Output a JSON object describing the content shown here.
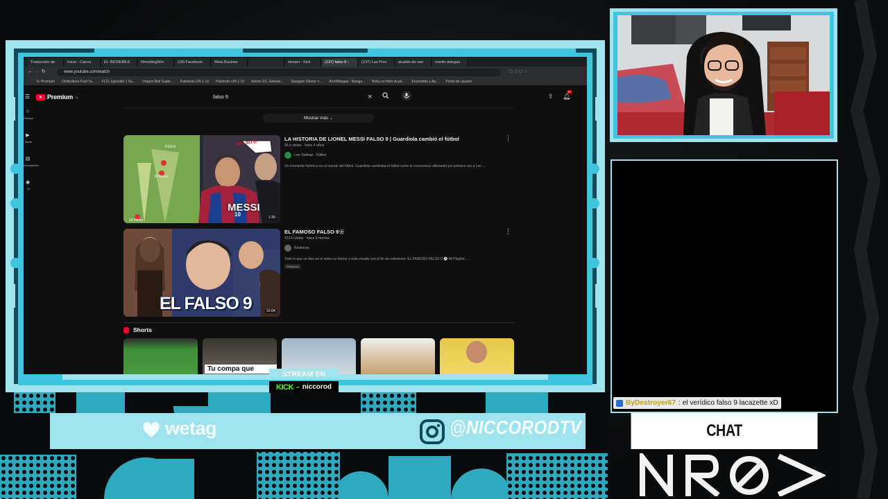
{
  "browser": {
    "tabs": [
      "Traducción de",
      "Inicio - Canva",
      "EL INCREIBLE",
      "WrestlingWor",
      "(18) Facebook",
      "Meta Busines",
      "",
      "stream - Kick",
      "(137) falso 9 -",
      "(137) Las Prec",
      "alcalde de san",
      "martin ødegaa"
    ],
    "active_tab_index": 8,
    "url": "www.youtube.com/watch",
    "bookmarks": [
      "Tv Premium",
      "Ochikobore Fruit Ta...",
      "FLCL Episodio 1 Su...",
      "Dragon Ball Super...",
      "Paletools v25.1.15",
      "Paletools v25.1.12",
      "Anime-SS, Gekkan...",
      "Tasogare Otome ×...",
      "ArchMangas - Manga...",
      "Boku no Hero Acad...",
      "Encendido y Ap...",
      "Portal de usuario"
    ]
  },
  "youtube": {
    "brand": "Premium",
    "brand_sup": "CL",
    "search_query": "falso 9",
    "notification_count": "9+",
    "sidebar": [
      {
        "icon": "home-icon",
        "label": "Principal"
      },
      {
        "icon": "shorts-icon",
        "label": "Shorts"
      },
      {
        "icon": "subscriptions-icon",
        "label": "Suscripciones"
      },
      {
        "icon": "you-icon",
        "label": "Tú"
      }
    ],
    "show_more": "Mostrar más",
    "videos": [
      {
        "title": "LA HISTORIA DE LIONEL MESSI FALSO 9 | Guardiola cambió el fútbol",
        "meta": "96 k vistas · hace 4 años",
        "channel": "Leo Salinas · Fútbol",
        "description": "Un momento histórico en el mundo del fútbol. Guardiola cambiaba el fútbol como lo conocemos utilizando por primera vez a Leo ...",
        "duration": "1:35",
        "thumb_text": [
          "¡FALSO 9!",
          "MESSI",
          "10",
          "9 Eto'o",
          "10 Messi",
          "14 Henry"
        ]
      },
      {
        "title": "EL FAMOSO FALSO 9",
        "meta": "151 k vistas · hace 9 meses",
        "channel": "Kevinnnn",
        "description": "Todo lo que se dice en el video es humor y esta creado con el fin de entretener. EL FAMOSO FALSO 9 ⚽ Mi Playlist: ...",
        "chip": "Subtítulos",
        "duration": "10:04",
        "thumb_text": [
          "EL FALSO 9"
        ]
      }
    ],
    "shorts_heading": "Shorts",
    "shorts_caption": "Tu compa que"
  },
  "overlay": {
    "stream_label": "STREAM EN",
    "kick_label": "KICK",
    "kick_user": "niccorod",
    "sponsor": "wetag",
    "instagram": "@NICCORODTV",
    "chat_title": "CHAT",
    "chat_message": {
      "user": "ByDestroyer67",
      "text": ": el verídico falso 9 lacazette xD"
    },
    "colors": {
      "frame_light": "#9fe3ef",
      "frame_accent": "#3ec6de",
      "frame_dark": "#0e4a5a",
      "kick_green": "#53fc18",
      "youtube_red": "#ff0033"
    }
  }
}
